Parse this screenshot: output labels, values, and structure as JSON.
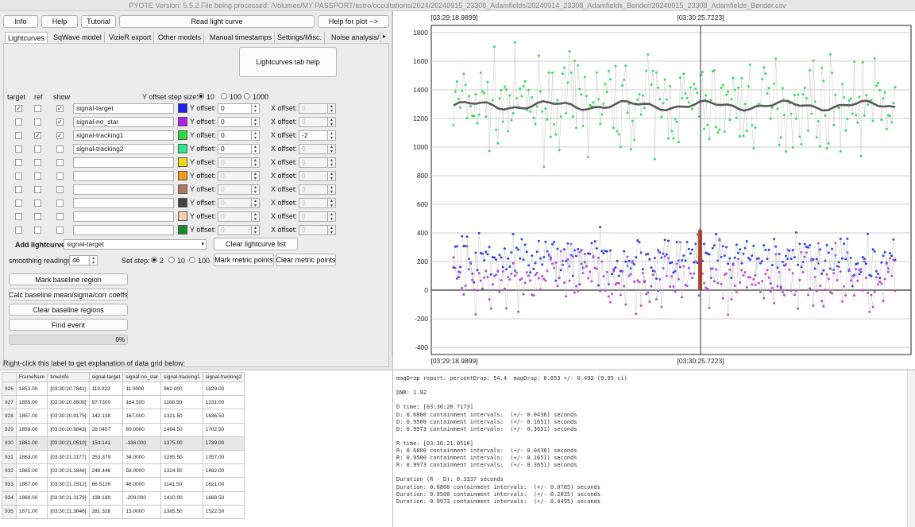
{
  "window": {
    "title": "PYOTE Version: 5.5.2  File being processed: /Volumes/MY PASSPORT/astro/occultations/2024/20240915_23308_Adamfields/20240914_23308_Adamfields_Bender/20240915_23308_Adamfields_Bender.csv"
  },
  "toolbar": {
    "info": "Info",
    "help": "Help",
    "tutorial": "Tutorial",
    "read_lc": "Read light curve",
    "help_plot": "Help for plot -->"
  },
  "tabs": [
    "Lightcurves",
    "SqWave model",
    "VizieR export",
    "Other models",
    "Manual timestamps",
    "Settings/Misc.",
    "Noise analysis/"
  ],
  "lc_tab": {
    "help_button": "Lightcurves tab help",
    "col_target": "target",
    "col_ref": "ref",
    "col_show": "show",
    "yoffset_step_label": "Y offset step size:",
    "yoffset_steps": [
      "10",
      "100",
      "1000"
    ],
    "yoffset_label": "Y offset:",
    "xoffset_label": "X offset:",
    "rows": [
      {
        "target": true,
        "ref": false,
        "show": true,
        "name": "signal-target",
        "color": "#1a23e6",
        "y": "0",
        "x": "0",
        "enabled": true,
        "x_enabled": false
      },
      {
        "target": false,
        "ref": false,
        "show": true,
        "name": "signal-no_star",
        "color": "#b41ee0",
        "y": "0",
        "x": "0",
        "enabled": true,
        "x_enabled": false
      },
      {
        "target": false,
        "ref": true,
        "show": true,
        "name": "signal-tracking1",
        "color": "#26e03a",
        "y": "0",
        "x": "-2",
        "enabled": true,
        "x_enabled": true
      },
      {
        "target": false,
        "ref": false,
        "show": false,
        "name": "signal-tracking2",
        "color": "#2ee88a",
        "y": "0",
        "x": "0",
        "enabled": true,
        "x_enabled": false
      },
      {
        "target": false,
        "ref": false,
        "show": false,
        "name": "",
        "color": "#f2dc1a",
        "y": "0",
        "x": "0",
        "enabled": false,
        "x_enabled": false
      },
      {
        "target": false,
        "ref": false,
        "show": false,
        "name": "",
        "color": "#f59a18",
        "y": "0",
        "x": "0",
        "enabled": false,
        "x_enabled": false
      },
      {
        "target": false,
        "ref": false,
        "show": false,
        "name": "",
        "color": "#ad7a5c",
        "y": "0",
        "x": "0",
        "enabled": false,
        "x_enabled": false
      },
      {
        "target": false,
        "ref": false,
        "show": false,
        "name": "",
        "color": "#3f4642",
        "y": "0",
        "x": "0",
        "enabled": false,
        "x_enabled": false
      },
      {
        "target": false,
        "ref": false,
        "show": false,
        "name": "",
        "color": "#fbcfa5",
        "y": "0",
        "x": "0",
        "enabled": false,
        "x_enabled": false
      },
      {
        "target": false,
        "ref": false,
        "show": false,
        "name": "",
        "color": "#1a8a22",
        "y": "0",
        "x": "0",
        "enabled": false,
        "x_enabled": false
      }
    ],
    "add_lc_label": "Add lightcurve",
    "add_lc_value": "signal-target",
    "clear_lc_list": "Clear lightcurve list",
    "smoothing_label": "smoothing readings",
    "smoothing_value": "46",
    "set_step_label": "Set step:",
    "set_steps": [
      "2",
      "10",
      "100"
    ],
    "mark_metric": "Mark metric points",
    "clear_metric": "Clear metric points",
    "mark_baseline": "Mark baseline region",
    "calc_baseline": "Calc baseline mean/sigma/corr coeffs",
    "clear_baseline": "Clear baseline regions",
    "find_event": "Find event",
    "progress": "0%"
  },
  "grid": {
    "label": "Right-click this label to get explanation of data grid below:",
    "headers": [
      "FrameNum",
      "timeInfo",
      "signal-target",
      "signal-no_star",
      "signal-tracking1",
      "signal-tracking2"
    ],
    "rows": [
      {
        "idx": "926",
        "cells": [
          "1853.00",
          "[03:30:20.7841]",
          "119.023",
          "11.0000",
          "962.000",
          "1629.00"
        ]
      },
      {
        "idx": "927",
        "cells": [
          "1855.00",
          "[03:30:20.8508]",
          "97.7300",
          "164.500",
          "1168.50",
          "1231.00"
        ]
      },
      {
        "idx": "928",
        "cells": [
          "1857.00",
          "[03:30:20.9175]",
          "142.138",
          "167.000",
          "1321.50",
          "1636.50"
        ]
      },
      {
        "idx": "929",
        "cells": [
          "1859.00",
          "[03:30:20.9843]",
          "28.0457",
          "80.0000",
          "1494.50",
          "1702.50"
        ]
      },
      {
        "idx": "930",
        "cells": [
          "1861.00",
          "[03:30:21.0510]",
          "154.141",
          "-136.000",
          "1375.00",
          "1739.00"
        ],
        "selected": true
      },
      {
        "idx": "931",
        "cells": [
          "1863.00",
          "[03:30:21.1177]",
          "253.379",
          "34.0000",
          "1285.50",
          "1357.00"
        ]
      },
      {
        "idx": "932",
        "cells": [
          "1865.00",
          "[03:30:21.1844]",
          "248.446",
          "58.0000",
          "1324.50",
          "1482.00"
        ]
      },
      {
        "idx": "933",
        "cells": [
          "1867.00",
          "[03:30:21.2512]",
          "66.5126",
          "46.0000",
          "1141.50",
          "1621.00"
        ]
      },
      {
        "idx": "934",
        "cells": [
          "1869.00",
          "[03:30:21.3179]",
          "199.189",
          "-209.000",
          "1410.00",
          "1669.50"
        ]
      },
      {
        "idx": "935",
        "cells": [
          "1871.00",
          "[03:30:21.3846]",
          "281.328",
          "13.0000",
          "1385.50",
          "1522.50"
        ]
      }
    ]
  },
  "report": {
    "lines": [
      "magDrop report: percentDrop: 54.4  magDrop: 0.853 +/- 0.493 (0.95 ci)",
      "",
      "DNR: 1.92",
      "",
      "D time: [03:30:20.7173]",
      "D: 0.6800 containment intervals:  (+/- 0.0436) seconds",
      "D: 0.9500 containment intervals:  (+/- 0.1651) seconds",
      "D: 0.9973 containment intervals:  (+/- 0.3651) seconds",
      "",
      "R time: [03:30:21.0510]",
      "R: 0.6800 containment intervals:  (+/- 0.0436) seconds",
      "R: 0.9500 containment intervals:  (+/- 0.1651) seconds",
      "R: 0.9973 containment intervals:  (+/- 0.3651) seconds",
      "",
      "Duration (R - D): 0.3337 seconds",
      "Duration: 0.6800 containment intervals:  (+/- 0.0705) seconds",
      "Duration: 0.9500 containment intervals:  (+/- 0.2035) seconds",
      "Duration: 0.9973 containment intervals:  (+/- 0.4495) seconds"
    ]
  },
  "chart_data": {
    "type": "scatter",
    "title": "",
    "xlabel": "",
    "ylabel": "",
    "x_tick_labels": [
      "[03:29:18.9899]",
      "[03:30:25.7223]"
    ],
    "ylim": [
      -450,
      1850
    ],
    "y_ticks": [
      -400,
      -200,
      0,
      200,
      400,
      600,
      800,
      1000,
      1200,
      1400,
      1600,
      1800
    ],
    "grid": true,
    "cursor_label": "[03:30:25.7223]",
    "series": [
      {
        "color": "#22e04a",
        "mean": 1300,
        "sigma": 150,
        "kind": "points"
      },
      {
        "color": "#5a5a5a",
        "mean": 1290,
        "sigma": 30,
        "kind": "smoothed"
      },
      {
        "color": "#2038e0",
        "mean": 220,
        "sigma": 80,
        "kind": "points"
      },
      {
        "color": "#b33fd8",
        "mean": 80,
        "sigma": 110,
        "kind": "points"
      }
    ],
    "colors": {
      "target": "#1a23e6",
      "no_star": "#b41ee0",
      "tracking1": "#26e03a",
      "smoothed": "#606060",
      "event": "#d42020"
    }
  }
}
